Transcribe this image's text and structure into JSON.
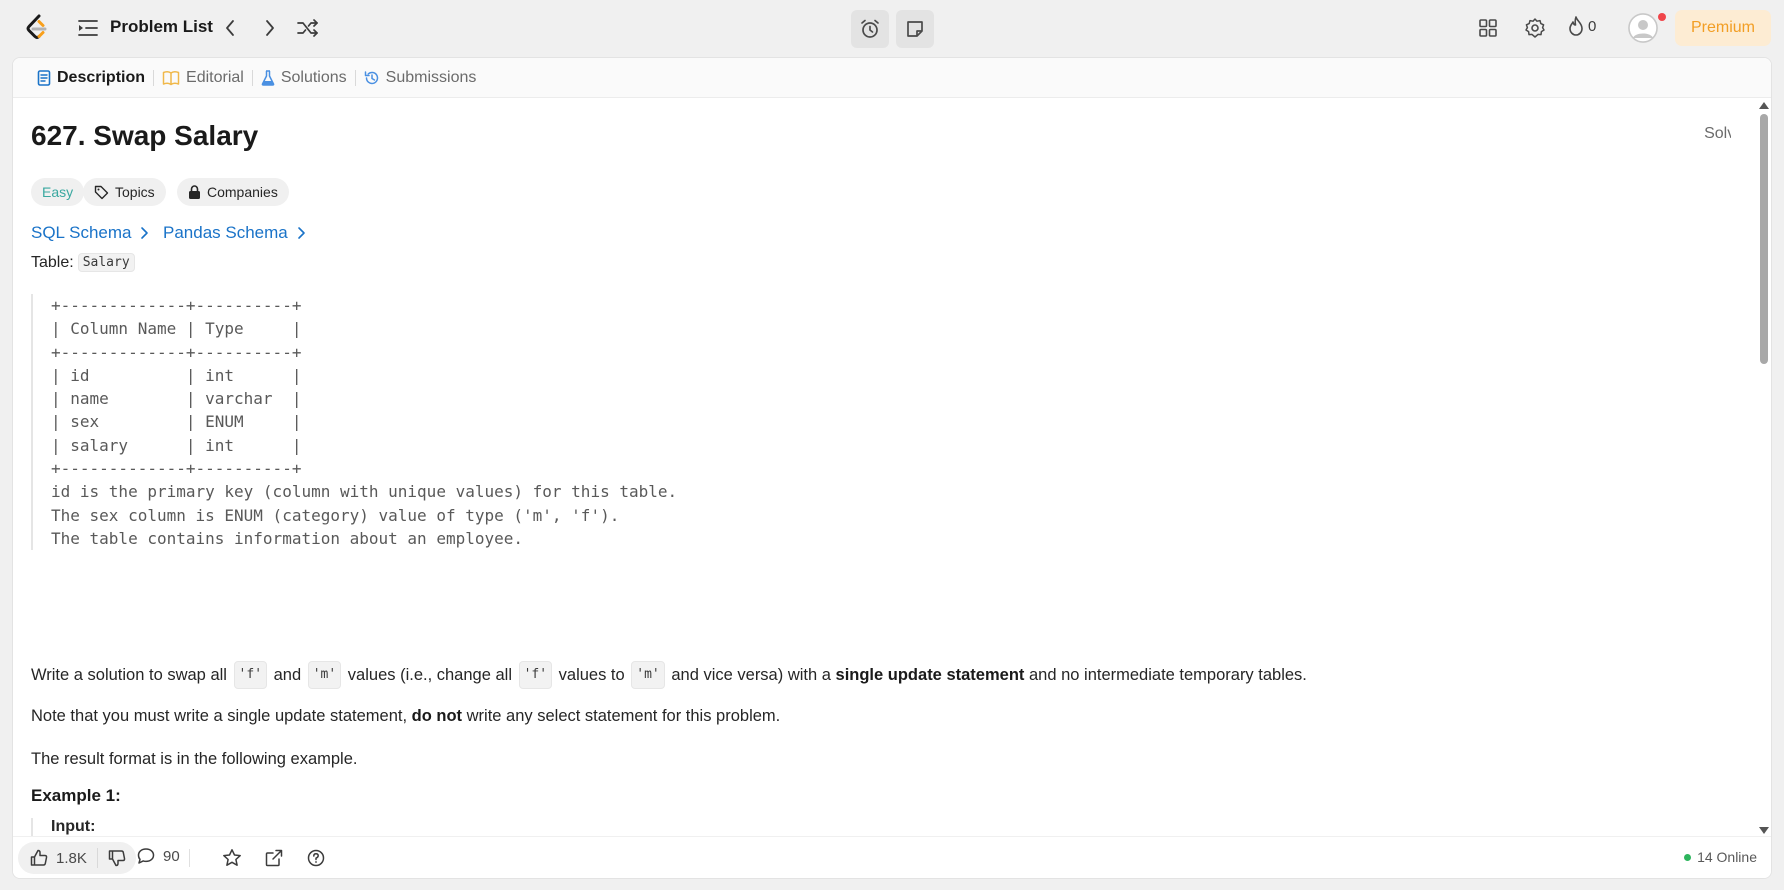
{
  "topnav": {
    "problem_list_label": "Problem List",
    "streak_count": "0",
    "premium_label": "Premium"
  },
  "tabs": [
    {
      "label": "Description",
      "active": true
    },
    {
      "label": "Editorial",
      "active": false
    },
    {
      "label": "Solutions",
      "active": false
    },
    {
      "label": "Submissions",
      "active": false
    }
  ],
  "problem": {
    "title": "627. Swap Salary",
    "status": "Solved",
    "difficulty": "Easy",
    "topics_label": "Topics",
    "companies_label": "Companies",
    "sql_schema_label": "SQL Schema",
    "pandas_schema_label": "Pandas Schema",
    "table_label": "Table:",
    "table_name": "Salary",
    "schema_lines": [
      "+-------------+----------+",
      "| Column Name | Type     |",
      "+-------------+----------+",
      "| id          | int      |",
      "| name        | varchar  |",
      "| sex         | ENUM     |",
      "| salary      | int      |",
      "+-------------+----------+",
      "id is the primary key (column with unique values) for this table.",
      "The sex column is ENUM (category) value of type ('m', 'f').",
      "The table contains information about an employee."
    ],
    "para1": {
      "t1": "Write a solution to swap all ",
      "c1": "'f'",
      "t2": " and ",
      "c2": "'m'",
      "t3": " values (i.e., change all ",
      "c3": "'f'",
      "t4": " values to ",
      "c4": "'m'",
      "t5": " and vice versa) with a ",
      "b1": "single update statement",
      "t6": " and no intermediate temporary tables."
    },
    "para2": {
      "t1": "Note that you must write a single update statement, ",
      "b1": "do not",
      "t2": " write any select statement for this problem."
    },
    "para3": "The result format is in the following example.",
    "example_title": "Example 1:",
    "input_label": "Input:"
  },
  "bottombar": {
    "likes": "1.8K",
    "comments": "90",
    "online": "14 Online"
  },
  "colors": {
    "accent_link": "#1a73c8",
    "easy": "#3aa8a0",
    "solved": "#2db55d",
    "premium_text": "#f29e24",
    "premium_bg": "#fdecd3"
  }
}
